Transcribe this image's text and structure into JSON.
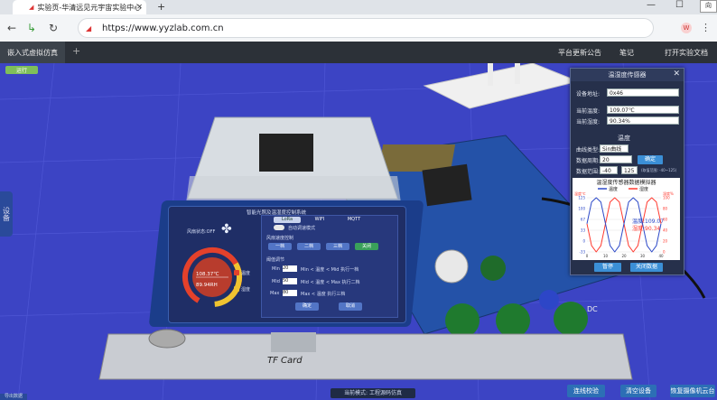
{
  "browser": {
    "tab_title": "实验页-华清远见元宇宙实验中心",
    "url": "https://www.yyzlab.com.cn",
    "avatar": "W",
    "corner_tooltip": "向"
  },
  "app": {
    "tab_label": "嵌入式虚拟仿真",
    "menu": [
      "平台更新公告",
      "笔记",
      "打开实验文档"
    ],
    "device_tab": "设备",
    "mode_badge": "运行"
  },
  "sensor_panel": {
    "title": "温湿度传感器",
    "device_addr_label": "设备地址:",
    "device_addr_value": "0x46",
    "cur_temp_label": "当前温度:",
    "cur_temp_value": "109.07℃",
    "cur_hum_label": "当前湿度:",
    "cur_hum_value": "90.34%",
    "section_temp": "温度",
    "curve_type_label": "曲线类型:",
    "curve_type_value": "Sin曲线",
    "data_period_label": "数据周期:",
    "data_period_value": "20",
    "data_range_label": "数据范围:",
    "range_min": "-40",
    "range_max": "125",
    "range_hint": "(取值范围: -40~125)",
    "confirm_button": "确定",
    "simulator_title": "温湿度传感器数据模拟器",
    "pause_button": "暂停",
    "close_button": "关闭数据"
  },
  "chart_data": {
    "type": "line",
    "title": "温湿度传感器数据模拟器",
    "series": [
      {
        "name": "温度",
        "color": "#ff3b30",
        "x": [
          0,
          2.5,
          5,
          7.5,
          10,
          12.5,
          15,
          17.5,
          20,
          22.5,
          25,
          27.5,
          30,
          32.5,
          35,
          37.5,
          40
        ],
        "values": [
          46,
          -21,
          -40,
          -21,
          46,
          112,
          125,
          112,
          46,
          -21,
          -40,
          -21,
          46,
          112,
          125,
          112,
          46
        ]
      },
      {
        "name": "湿度",
        "color": "#2c49c8",
        "x": [
          0,
          2.5,
          5,
          7.5,
          10,
          12.5,
          15,
          17.5,
          20,
          22.5,
          25,
          27.5,
          30,
          32.5,
          35,
          37.5,
          40
        ],
        "values": [
          46,
          112,
          125,
          112,
          46,
          -21,
          -40,
          -21,
          46,
          112,
          125,
          112,
          46,
          -21,
          -40,
          -21,
          46
        ]
      }
    ],
    "ylabel_left": "温度℃",
    "ylabel_right": "湿度%",
    "yticks_left": [
      "125",
      "100",
      "67",
      "33",
      "0",
      "-33"
    ],
    "yticks_right": [
      "100",
      "80",
      "60",
      "40",
      "20",
      "0"
    ],
    "xticks": [
      "0",
      "10",
      "20",
      "30",
      "40"
    ],
    "xlim": [
      0,
      40
    ],
    "ylim": [
      -40,
      125
    ],
    "readout_temp": "温度:109.07",
    "readout_hum": "湿度:90.34"
  },
  "device_screen": {
    "title": "智能光照及温湿度控制系统",
    "fan_status": "风扇状态:OFF",
    "gauge_temp": "108.37℃",
    "gauge_hum": "89.94RH",
    "legend_temp": "温度",
    "legend_hum": "湿度",
    "tabs": [
      "LoRa",
      "WIFI",
      "MQTT"
    ],
    "mode_label": "自动调速模式",
    "fan_section": "风扇速度控制",
    "gear_buttons": [
      "一档",
      "二档",
      "三档",
      "关闭"
    ],
    "threshold_label": "阈值调节",
    "min_label": "Min",
    "min_value": "20",
    "min_rule": "Min < 温度 < Mid  执行一档",
    "mid_label": "Mid",
    "mid_value": "50",
    "mid_rule": "Mid < 温度 < Max  执行二档",
    "max_label": "Max",
    "max_value": "80",
    "max_rule": "Max < 温度  执行三档",
    "ok_button": "确定",
    "cancel_button": "取消"
  },
  "board": {
    "tf_label": "TF Card",
    "label_dc": "DC"
  },
  "bottom": {
    "status": "当前模式: 工程源码仿真",
    "buttons": [
      "连线校验",
      "清空设备",
      "恢复摄像机云台"
    ],
    "corner_label": "导出数据"
  }
}
